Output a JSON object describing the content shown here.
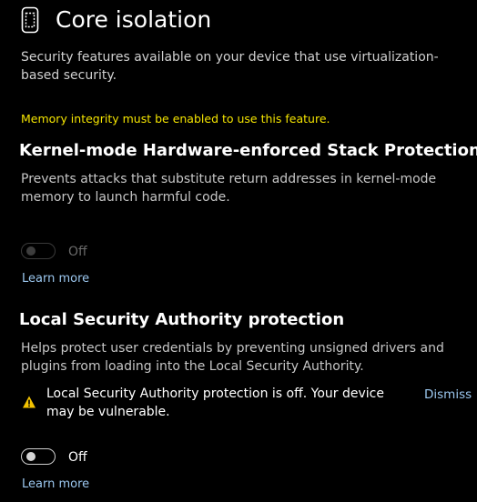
{
  "header": {
    "icon": "core-isolation-chip-icon",
    "title": "Core isolation",
    "description": "Security features available on your device that use virtualization-based security."
  },
  "warning": {
    "text": "Memory integrity must be enabled to use this feature.",
    "color": "#f5e500"
  },
  "stack_protection": {
    "title": "Kernel-mode Hardware-enforced Stack Protection",
    "description": "Prevents attacks that substitute return addresses in kernel-mode memory to launch harmful code.",
    "toggle": {
      "state": "off",
      "enabled": false,
      "label": "Off"
    },
    "learn_more": "Learn more"
  },
  "lsa": {
    "title": "Local Security Authority protection",
    "description": "Helps protect user credentials by preventing unsigned drivers and plugins from loading into the Local Security Authority.",
    "infobar": {
      "icon": "warning-triangle-icon",
      "text": "Local Security Authority protection is off. Your device may be vulnerable.",
      "dismiss": "Dismiss"
    },
    "toggle": {
      "state": "off",
      "enabled": true,
      "label": "Off"
    },
    "learn_more": "Learn more"
  },
  "colors": {
    "background": "#000000",
    "accent_link": "#9cc8f0",
    "warning_icon": "#f2c200"
  }
}
